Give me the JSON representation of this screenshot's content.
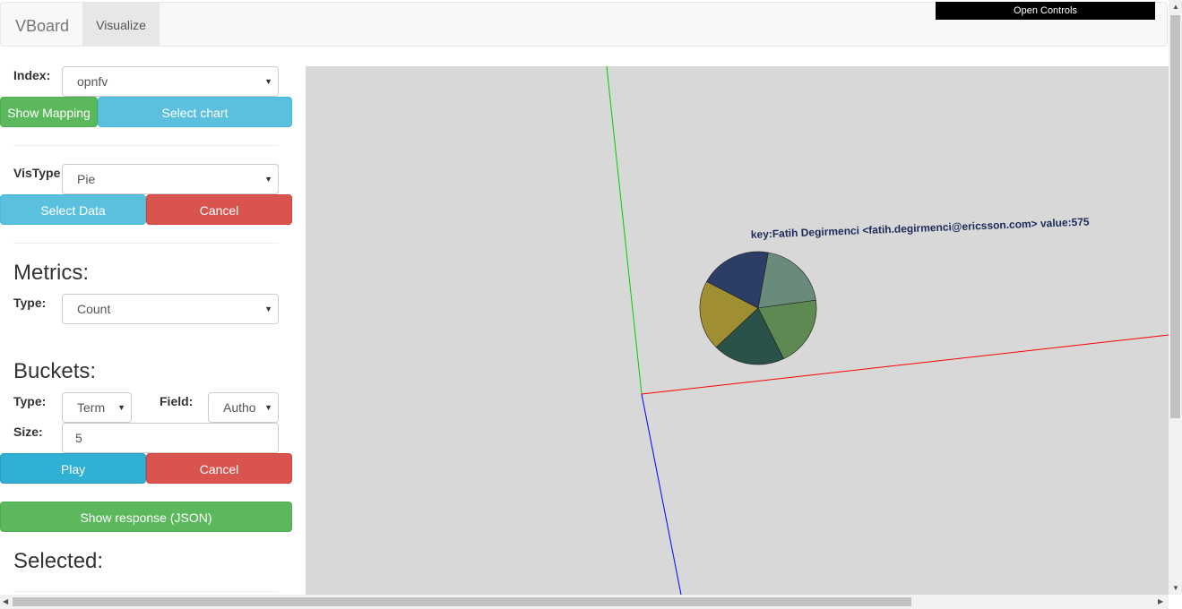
{
  "navbar": {
    "brand": "VBoard",
    "tab": "Visualize",
    "open_controls": "Open Controls"
  },
  "index": {
    "label": "Index:",
    "value": "opnfv"
  },
  "buttons": {
    "show_mapping": "Show Mapping",
    "select_chart": "Select chart",
    "select_data": "Select Data",
    "cancel": "Cancel",
    "play": "Play",
    "show_response": "Show response (JSON)"
  },
  "vistype": {
    "label": "VisType",
    "value": "Pie"
  },
  "metrics": {
    "heading": "Metrics:",
    "type_label": "Type:",
    "type_value": "Count"
  },
  "buckets": {
    "heading": "Buckets:",
    "type_label": "Type:",
    "type_value": "Term",
    "field_label": "Field:",
    "field_value": "Autho",
    "size_label": "Size:",
    "size_value": "5"
  },
  "selected": {
    "heading": "Selected:"
  },
  "scene": {
    "tooltip": "key:Fatih Degirmenci <fatih.degirmenci@ericsson.com> value:575",
    "axis_colors": {
      "x": "#ff0000",
      "y": "#00cc00",
      "z": "#0000ff"
    },
    "pie_slices": [
      {
        "color": "#6a8b7c",
        "fraction": 0.2
      },
      {
        "color": "#5c8a52",
        "fraction": 0.2
      },
      {
        "color": "#2b5249",
        "fraction": 0.2
      },
      {
        "color": "#a08e33",
        "fraction": 0.2
      },
      {
        "color": "#2c3e66",
        "fraction": 0.2
      }
    ]
  }
}
